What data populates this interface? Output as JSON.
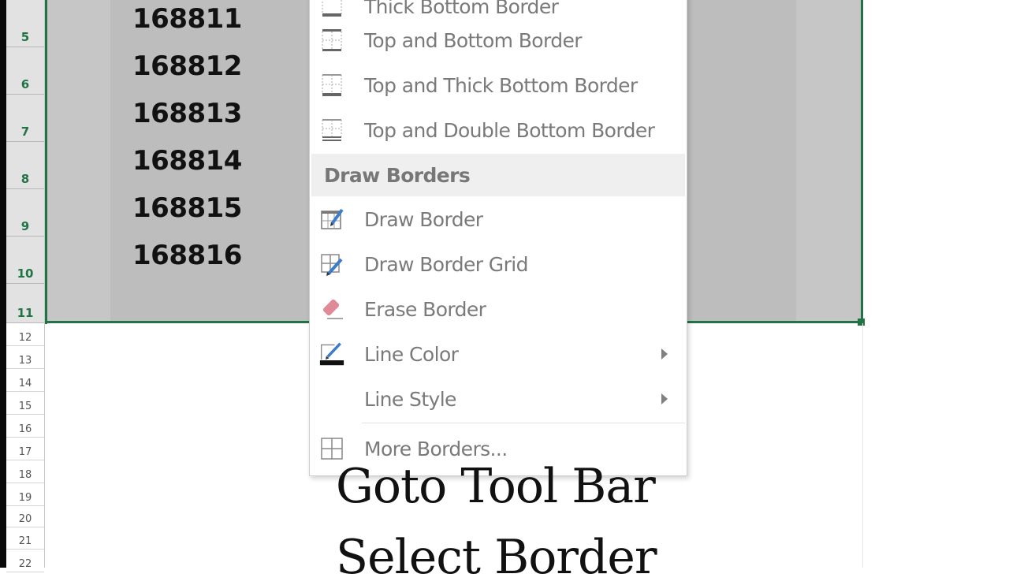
{
  "spreadsheet": {
    "row_headers": [
      "5",
      "6",
      "7",
      "8",
      "9",
      "10",
      "11",
      "12",
      "13",
      "14",
      "15",
      "16",
      "17",
      "18",
      "19",
      "20",
      "21",
      "22"
    ],
    "selected_rows": [
      "5",
      "6",
      "7",
      "8",
      "9",
      "10",
      "11"
    ],
    "cells": [
      "168811",
      "168812",
      "168813",
      "168814",
      "168815",
      "168816"
    ],
    "selection_color": "#217346"
  },
  "border_menu": {
    "partial_top_label": "Thick Bottom Border",
    "items": [
      {
        "label": "Top and Bottom Border",
        "icon": "top-bottom-border-icon"
      },
      {
        "label": "Top and Thick Bottom Border",
        "icon": "top-thick-bottom-border-icon"
      },
      {
        "label": "Top and Double Bottom Border",
        "icon": "top-double-bottom-border-icon"
      }
    ],
    "section_header": "Draw Borders",
    "draw_items": [
      {
        "label": "Draw Border",
        "icon": "draw-border-pencil-icon"
      },
      {
        "label": "Draw Border Grid",
        "icon": "draw-border-grid-icon"
      },
      {
        "label": "Erase Border",
        "icon": "eraser-icon"
      },
      {
        "label": "Line Color",
        "icon": "line-color-icon",
        "submenu": true
      },
      {
        "label": "Line Style",
        "icon": "",
        "submenu": true
      }
    ],
    "more_item": {
      "label": "More Borders...",
      "icon": "all-borders-grid-icon"
    }
  },
  "caption": {
    "line1": "Goto Tool Bar",
    "line2": "Select Border"
  }
}
